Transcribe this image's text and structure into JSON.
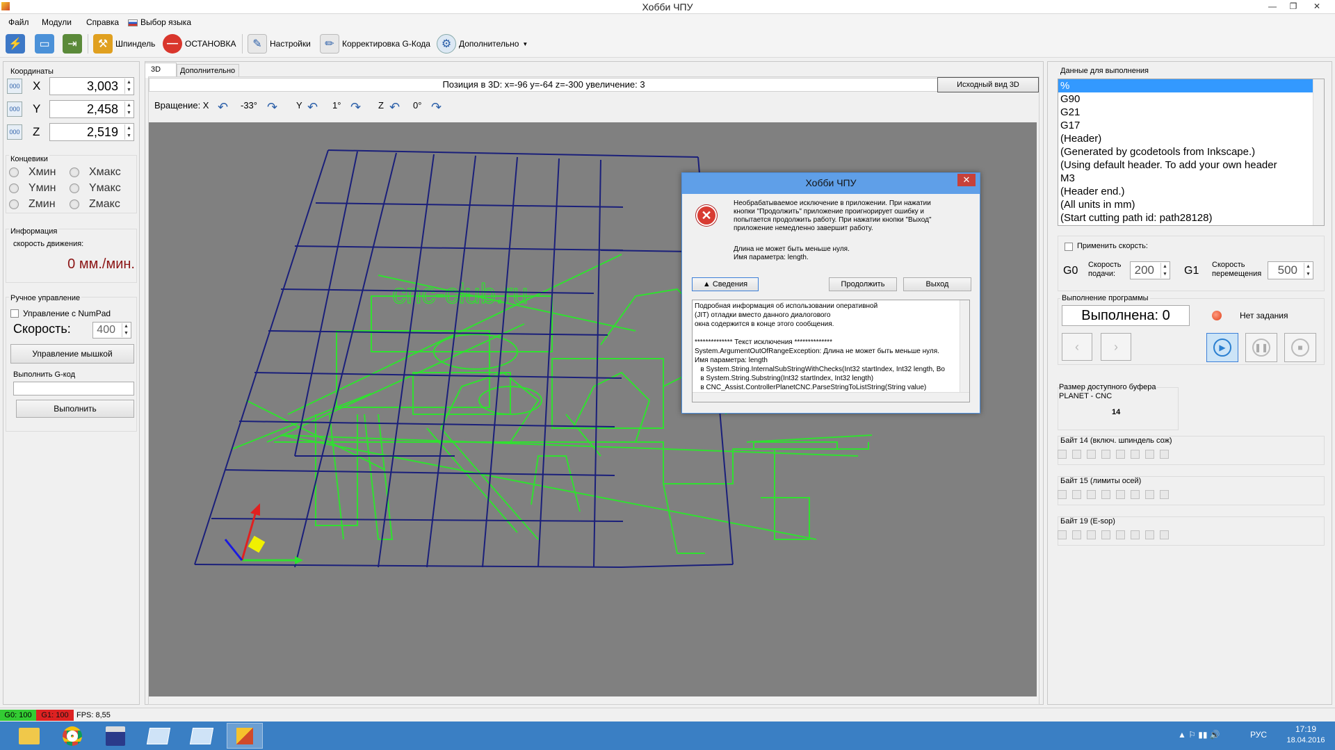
{
  "window": {
    "title": "Хобби ЧПУ"
  },
  "menu": {
    "file": "Файл",
    "modules": "Модули",
    "help": "Справка",
    "language": "Выбор языка"
  },
  "toolbar": {
    "spindle": "Шпиндель",
    "stop": "ОСТАНОВКА",
    "settings": "Настройки",
    "gcode_edit": "Корректировка G-Кода",
    "extra": "Дополнительно"
  },
  "coords": {
    "label": "Координаты",
    "x_label": "X",
    "x": "3,003",
    "y_label": "Y",
    "y": "2,458",
    "z_label": "Z",
    "z": "2,519",
    "btn": "000"
  },
  "limits": {
    "label": "Концевики",
    "xmin": "Хмин",
    "xmax": "Хмакс",
    "ymin": "Yмин",
    "ymax": "Yмакс",
    "zmin": "Zмин",
    "zmax": "Zмакс"
  },
  "info": {
    "label": "Информация",
    "speed_label": "скорость движения:",
    "speed": "0 мм./мин."
  },
  "manual": {
    "label": "Ручное управление",
    "numpad": "Управление с NumPad",
    "speed_label": "Скорость:",
    "speed": "400",
    "mouse_btn": "Управление мышкой"
  },
  "gcode_exec": {
    "label": "Выполнить G-код",
    "input": "",
    "run_btn": "Выполнить"
  },
  "tabs": {
    "tab_3d": "3D",
    "tab_extra": "Дополнительно"
  },
  "view": {
    "position": "Позиция в 3D: x=-96 y=-64 z=-300 увеличение: 3",
    "reset_btn": "Исходный вид 3D",
    "rotation_label": "Вращение: X",
    "rot_x": "-33°",
    "y_label": "Y",
    "rot_y": "1°",
    "z_label": "Z",
    "rot_z": "0°",
    "watermark": "cnc-club.ru"
  },
  "dialog": {
    "title": "Хобби ЧПУ",
    "close": "✕",
    "message": "Необрабатываемое исключение в приложении. При нажатии\nкнопки \"Продолжить\" приложение проигнорирует ошибку и\nпопытается продолжить работу. При нажатии кнопки \"Выход\"\nприложение немедленно завершит работу.",
    "detail_msg": "Длина не может быть меньше нуля.\nИмя параметра: length.",
    "details_btn": "▲ Сведения",
    "continue_btn": "Продолжить",
    "exit_btn": "Выход",
    "details_text": "Подробная информация об использовании оперативной\n(JIT) отладки вместо данного диалогового\nокна содержится в конце этого сообщения.\n\n************** Текст исключения **************\nSystem.ArgumentOutOfRangeException: Длина не может быть меньше нуля.\nИмя параметра: length\n   в System.String.InternalSubStringWithChecks(Int32 startIndex, Int32 length, Bo\n   в System.String.Substring(Int32 startIndex, Int32 length)\n   в CNC_Assist.ControllerPlanetCNC.ParseStringToListString(String value)"
  },
  "program": {
    "label": "Данные для выполнения",
    "lines": [
      "%",
      "G90",
      "G21",
      "G17",
      "(Header)",
      "(Generated by gcodetools from Inkscape.)",
      "(Using default header. To add your own header",
      "M3",
      "(Header end.)",
      "(All units in mm)",
      "(Start cutting path id: path28128)"
    ]
  },
  "speed": {
    "apply": "Применить скорсть:",
    "g0": "G0",
    "feed_label": "Скорость\nподачи:",
    "feed": "200",
    "g1": "G1",
    "move_label": "Скорость\nперемещения",
    "move": "500"
  },
  "execution": {
    "label": "Выполнение программы",
    "done": "Выполнена: 0",
    "status": "Нет задания",
    "prev": "‹",
    "next": "›"
  },
  "buffer": {
    "label": "Размер доступного буфера\nPLANET - CNC",
    "value": "14"
  },
  "bytes": {
    "b14": "Байт 14 (включ. шпиндель сож)",
    "b15": "Байт 15 (лимиты осей)",
    "b19": "Байт 19 (E-sop)"
  },
  "status": {
    "g0": "G0: 100",
    "g1": "G1: 100",
    "fps": "FPS: 8,55"
  },
  "taskbar": {
    "lang": "РУС",
    "time": "17:19",
    "date": "18.04.2016"
  },
  "colors": {
    "accent": "#3a7fc4",
    "grid": "#1a1f7a",
    "part": "#30e030",
    "stop": "#d9362c",
    "g0_bg": "#33cc33",
    "g1_bg": "#dd2222"
  }
}
